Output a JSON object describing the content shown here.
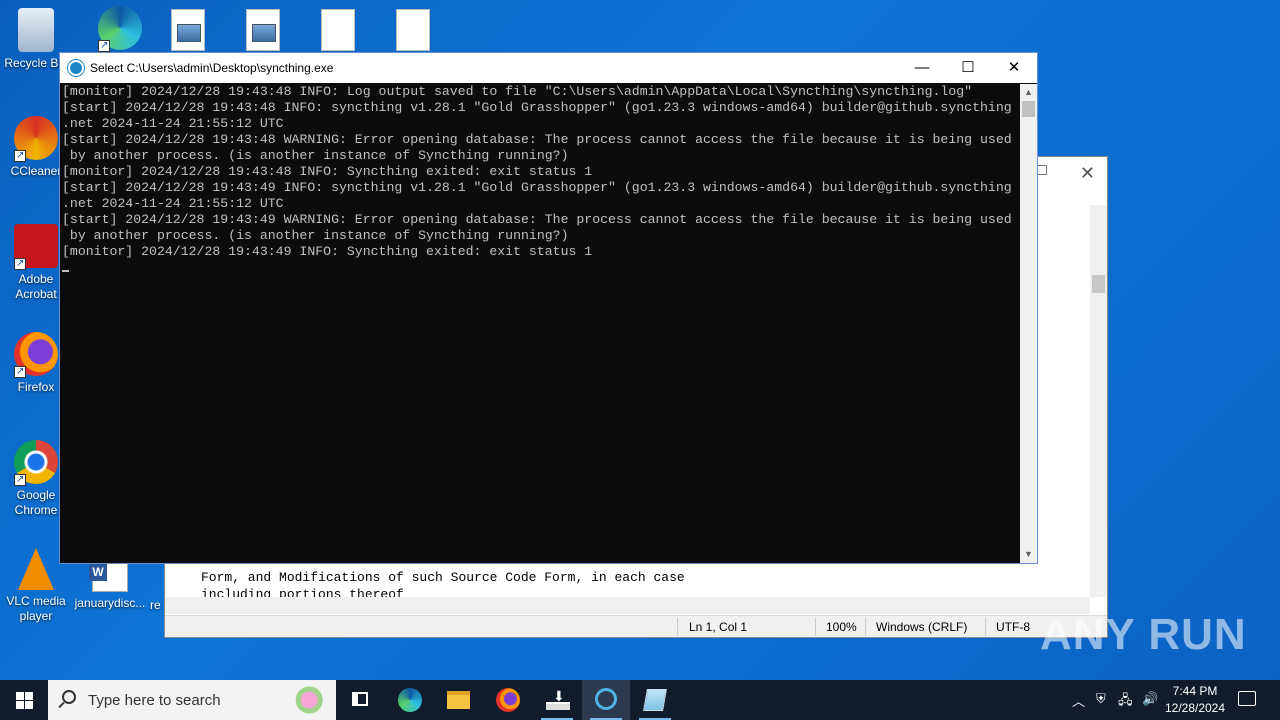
{
  "desktop": {
    "icons": [
      {
        "label": "Recycle Bin"
      },
      {
        "label": "CCleaner"
      },
      {
        "label": "Adobe Acrobat"
      },
      {
        "label": "Firefox"
      },
      {
        "label": "Google Chrome"
      },
      {
        "label": "VLC media player"
      },
      {
        "label": "januarydisc..."
      },
      {
        "label": "re"
      }
    ]
  },
  "console": {
    "title": "Select C:\\Users\\admin\\Desktop\\syncthing.exe",
    "lines": [
      "[monitor] 2024/12/28 19:43:48 INFO: Log output saved to file \"C:\\Users\\admin\\AppData\\Local\\Syncthing\\syncthing.log\"",
      "[start] 2024/12/28 19:43:48 INFO: syncthing v1.28.1 \"Gold Grasshopper\" (go1.23.3 windows-amd64) builder@github.syncthing",
      ".net 2024-11-24 21:55:12 UTC",
      "[start] 2024/12/28 19:43:48 WARNING: Error opening database: The process cannot access the file because it is being used",
      " by another process. (is another instance of Syncthing running?)",
      "[monitor] 2024/12/28 19:43:48 INFO: Syncthing exited: exit status 1",
      "[start] 2024/12/28 19:43:49 INFO: syncthing v1.28.1 \"Gold Grasshopper\" (go1.23.3 windows-amd64) builder@github.syncthing",
      ".net 2024-11-24 21:55:12 UTC",
      "[start] 2024/12/28 19:43:49 WARNING: Error opening database: The process cannot access the file because it is being used",
      " by another process. (is another instance of Syncthing running?)",
      "[monitor] 2024/12/28 19:43:49 INFO: Syncthing exited: exit status 1"
    ]
  },
  "notepad": {
    "text_lines": [
      "Form, and Modifications of such Source Code Form, in each case",
      "including portions thereof"
    ],
    "status": {
      "position": "Ln 1, Col 1",
      "zoom": "100%",
      "line_ending": "Windows (CRLF)",
      "encoding": "UTF-8"
    }
  },
  "watermark": "ANY RUN",
  "taskbar": {
    "search_placeholder": "Type here to search",
    "time": "7:44 PM",
    "date": "12/28/2024"
  }
}
